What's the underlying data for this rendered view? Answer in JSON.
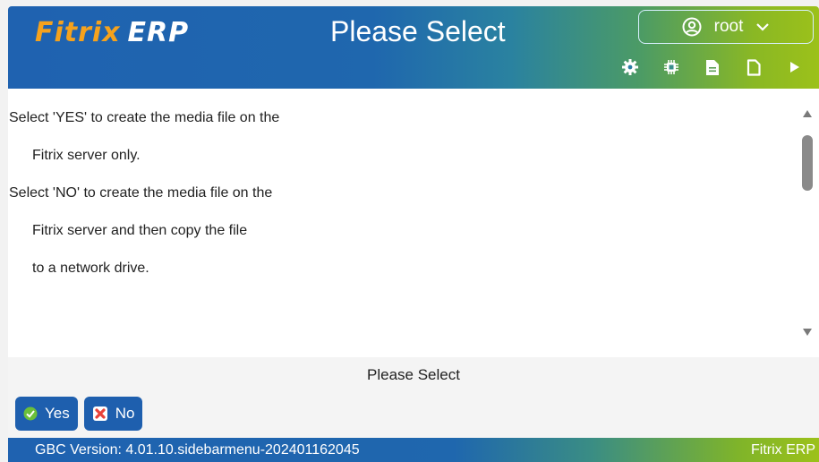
{
  "header": {
    "logo_brand": "Fitrix",
    "logo_suffix": "ERP",
    "title": "Please Select",
    "user": {
      "name": "root"
    },
    "toolbar": [
      {
        "icon": "gear-icon"
      },
      {
        "icon": "chip-icon"
      },
      {
        "icon": "document-filled-icon"
      },
      {
        "icon": "document-outline-icon"
      },
      {
        "icon": "play-icon"
      }
    ]
  },
  "message": {
    "lines": [
      "Select 'YES' to create the media file on the",
      "Fitrix server only.",
      "Select 'NO' to create the media file on the",
      "Fitrix server and then copy the file",
      "to a network drive."
    ]
  },
  "prompt": "Please Select",
  "buttons": {
    "yes_label": "Yes",
    "no_label": "No"
  },
  "footer": {
    "version": "GBC Version: 4.01.10.sidebarmenu-202401162045",
    "brand": "Fitrix ERP"
  },
  "colors": {
    "header_blue": "#1f62b0",
    "header_green": "#9cc11a",
    "logo_orange": "#f5a21d",
    "button_blue": "#1e5fae"
  }
}
